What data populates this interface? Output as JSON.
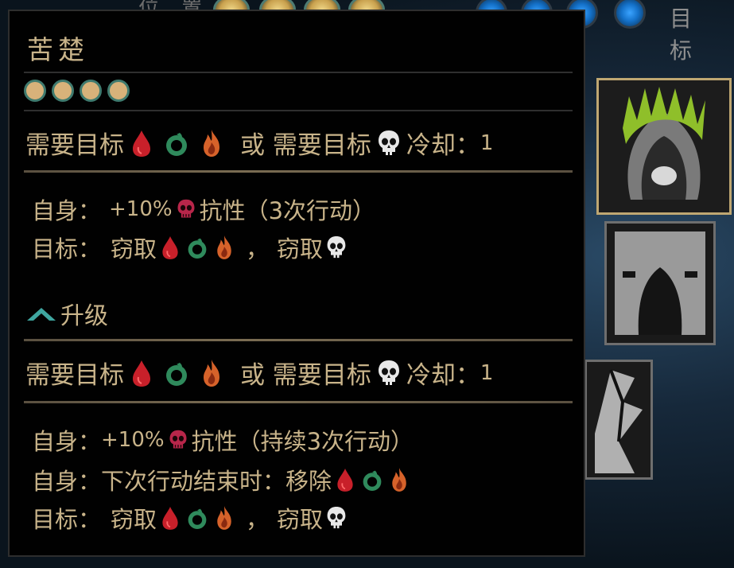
{
  "topbar": {
    "left_label": "位 置",
    "right_label": "目 标"
  },
  "tooltip": {
    "title": "苦楚",
    "rank_pips": 4,
    "base": {
      "requirement": {
        "prefix": "需要目标",
        "or_label": "或 需要目标",
        "cooldown_label": "冷却：",
        "cooldown_value": "1"
      },
      "self_line": {
        "label": "自身：",
        "pct": "+10%",
        "stat": "抗性（3次行动）"
      },
      "target_line": {
        "label": "目标：",
        "steal1": "窃取",
        "sep": "，",
        "steal2": "窃取"
      }
    },
    "upgrade": {
      "header": "升级",
      "requirement": {
        "prefix": "需要目标",
        "or_label": "或 需要目标",
        "cooldown_label": "冷却：",
        "cooldown_value": "1"
      },
      "self_line1": {
        "label": "自身：",
        "pct": "+10%",
        "stat": "抗性（持续3次行动）"
      },
      "self_line2": {
        "label": "自身：",
        "text": "下次行动结束时：移除"
      },
      "target_line": {
        "label": "目标：",
        "steal1": "窃取",
        "sep": "，",
        "steal2": "窃取"
      }
    }
  },
  "icons": {
    "bleed": "bleed-icon",
    "poison": "blight-icon",
    "burn": "burn-icon",
    "skull": "skull-icon",
    "resist_skull": "resist-skull-icon",
    "upgrade": "upgrade-chevron-icon"
  },
  "colors": {
    "text": "#c9b48a",
    "bleed": "#c8202a",
    "blight": "#2f8a5c",
    "burn": "#d6622a",
    "skull": "#e8e8e8",
    "resist_skull": "#b8264a",
    "pip_fill": "#d8b27a",
    "pip_border": "#3f7a6e"
  }
}
